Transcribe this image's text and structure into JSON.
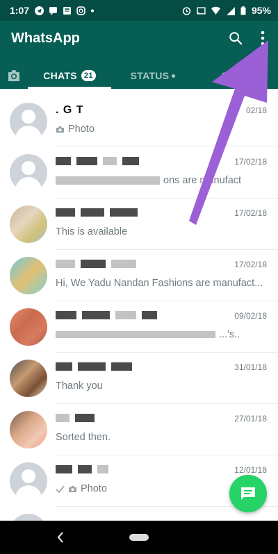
{
  "status_bar": {
    "time": "1:07",
    "battery": "95%"
  },
  "app": {
    "title": "WhatsApp"
  },
  "tabs": {
    "chats": "CHATS",
    "chats_count": "21",
    "status": "STATUS",
    "calls": "C"
  },
  "chats": [
    {
      "name": ". G T",
      "date": "02/18",
      "preview": "Photo"
    },
    {
      "name": "",
      "date": "17/02/18",
      "preview": "ons are manufact"
    },
    {
      "name": "",
      "date": "17/02/18",
      "preview": "This is available"
    },
    {
      "name": "",
      "date": "17/02/18",
      "preview": "Hi, We Yadu Nandan Fashions are manufact..."
    },
    {
      "name": "",
      "date": "09/02/18",
      "preview": "...'s.."
    },
    {
      "name": "",
      "date": "31/01/18",
      "preview": "Thank you"
    },
    {
      "name": "",
      "date": "27/01/18",
      "preview": "Sorted then."
    },
    {
      "name": "",
      "date": "12/01/18",
      "preview": "Photo"
    }
  ],
  "colors": {
    "header": "#075e54",
    "statusbar": "#054d44",
    "fab": "#25d366",
    "arrow": "#9b5fd6"
  }
}
